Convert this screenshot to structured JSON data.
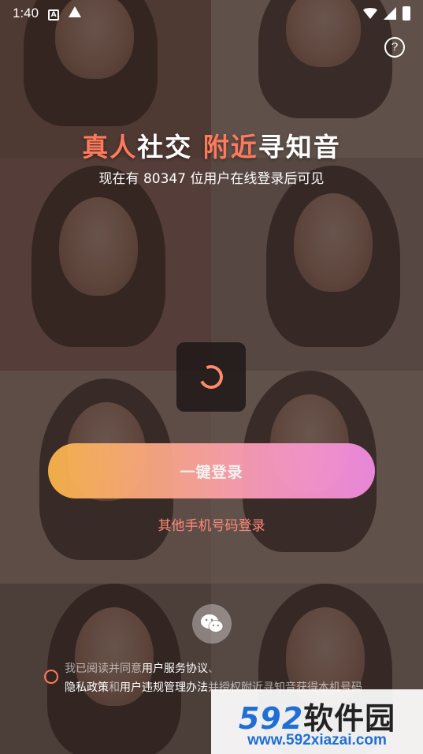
{
  "status_bar": {
    "time": "1:40"
  },
  "help": {
    "label": "?"
  },
  "headline": {
    "part1": "真人",
    "part2": "社交 ",
    "part3": "附近",
    "part4": "寻知音"
  },
  "subline": "现在有 80347 位用户在线登录后可见",
  "login_button": "一键登录",
  "other_login": "其他手机号码登录",
  "agreement": {
    "prefix": "我已阅读并同意",
    "link1": "用户服务协议",
    "sep1": "、",
    "link2": "隐私政策",
    "and": "和",
    "link3": "用户违规管理办法",
    "suffix": "并授权附近寻知音获得本机号码"
  },
  "watermark": {
    "brand_num": "592",
    "brand_cn": "软件园",
    "url": "www.592xiazai.com"
  },
  "colors": {
    "accent": "#ff7a5c",
    "button_gradient_start": "#ffb84a",
    "button_gradient_end": "#f78ee8",
    "watermark_blue": "#1f6fd4"
  }
}
